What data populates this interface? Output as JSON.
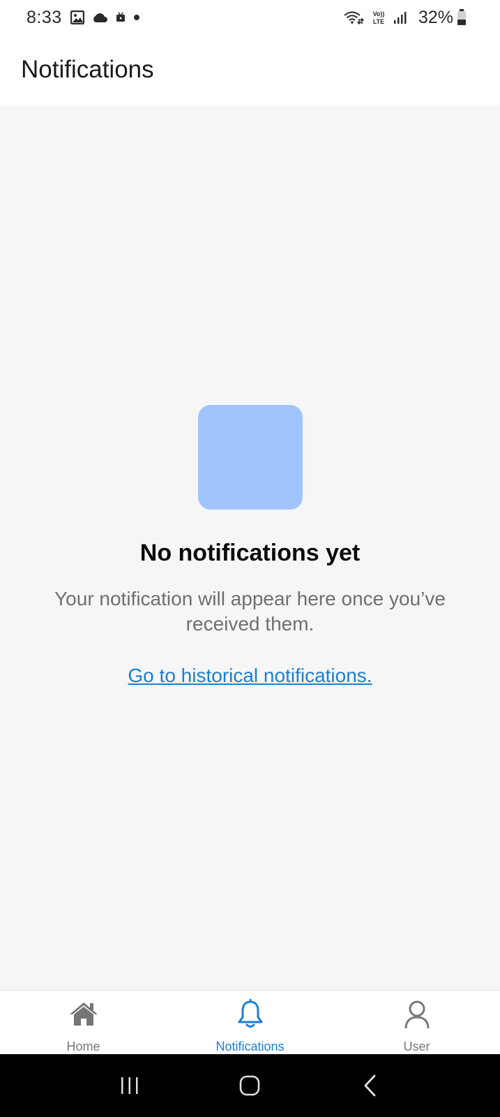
{
  "status_bar": {
    "time": "8:33",
    "battery": "32%",
    "icons_left": [
      "gallery-icon",
      "cloud-icon",
      "media-icon",
      "dot-icon"
    ],
    "icons_right": [
      "wifi-icon",
      "volte-icon",
      "signal-icon",
      "battery-icon"
    ]
  },
  "header": {
    "title": "Notifications"
  },
  "empty_state": {
    "title": "No notifications yet",
    "description": "Your notification will appear here once you’ve received them.",
    "link": "Go to historical notifications.",
    "illustration_color": "#a2c4fd"
  },
  "bottom_nav": {
    "items": [
      {
        "label": "Home",
        "icon": "home-icon",
        "active": false
      },
      {
        "label": "Notifications",
        "icon": "bell-icon",
        "active": true
      },
      {
        "label": "User",
        "icon": "user-icon",
        "active": false
      }
    ],
    "active_color": "#1a7fd4",
    "inactive_color": "#777777"
  },
  "system_nav": {
    "buttons": [
      "recent-apps-icon",
      "home-circle-icon",
      "back-icon"
    ]
  }
}
